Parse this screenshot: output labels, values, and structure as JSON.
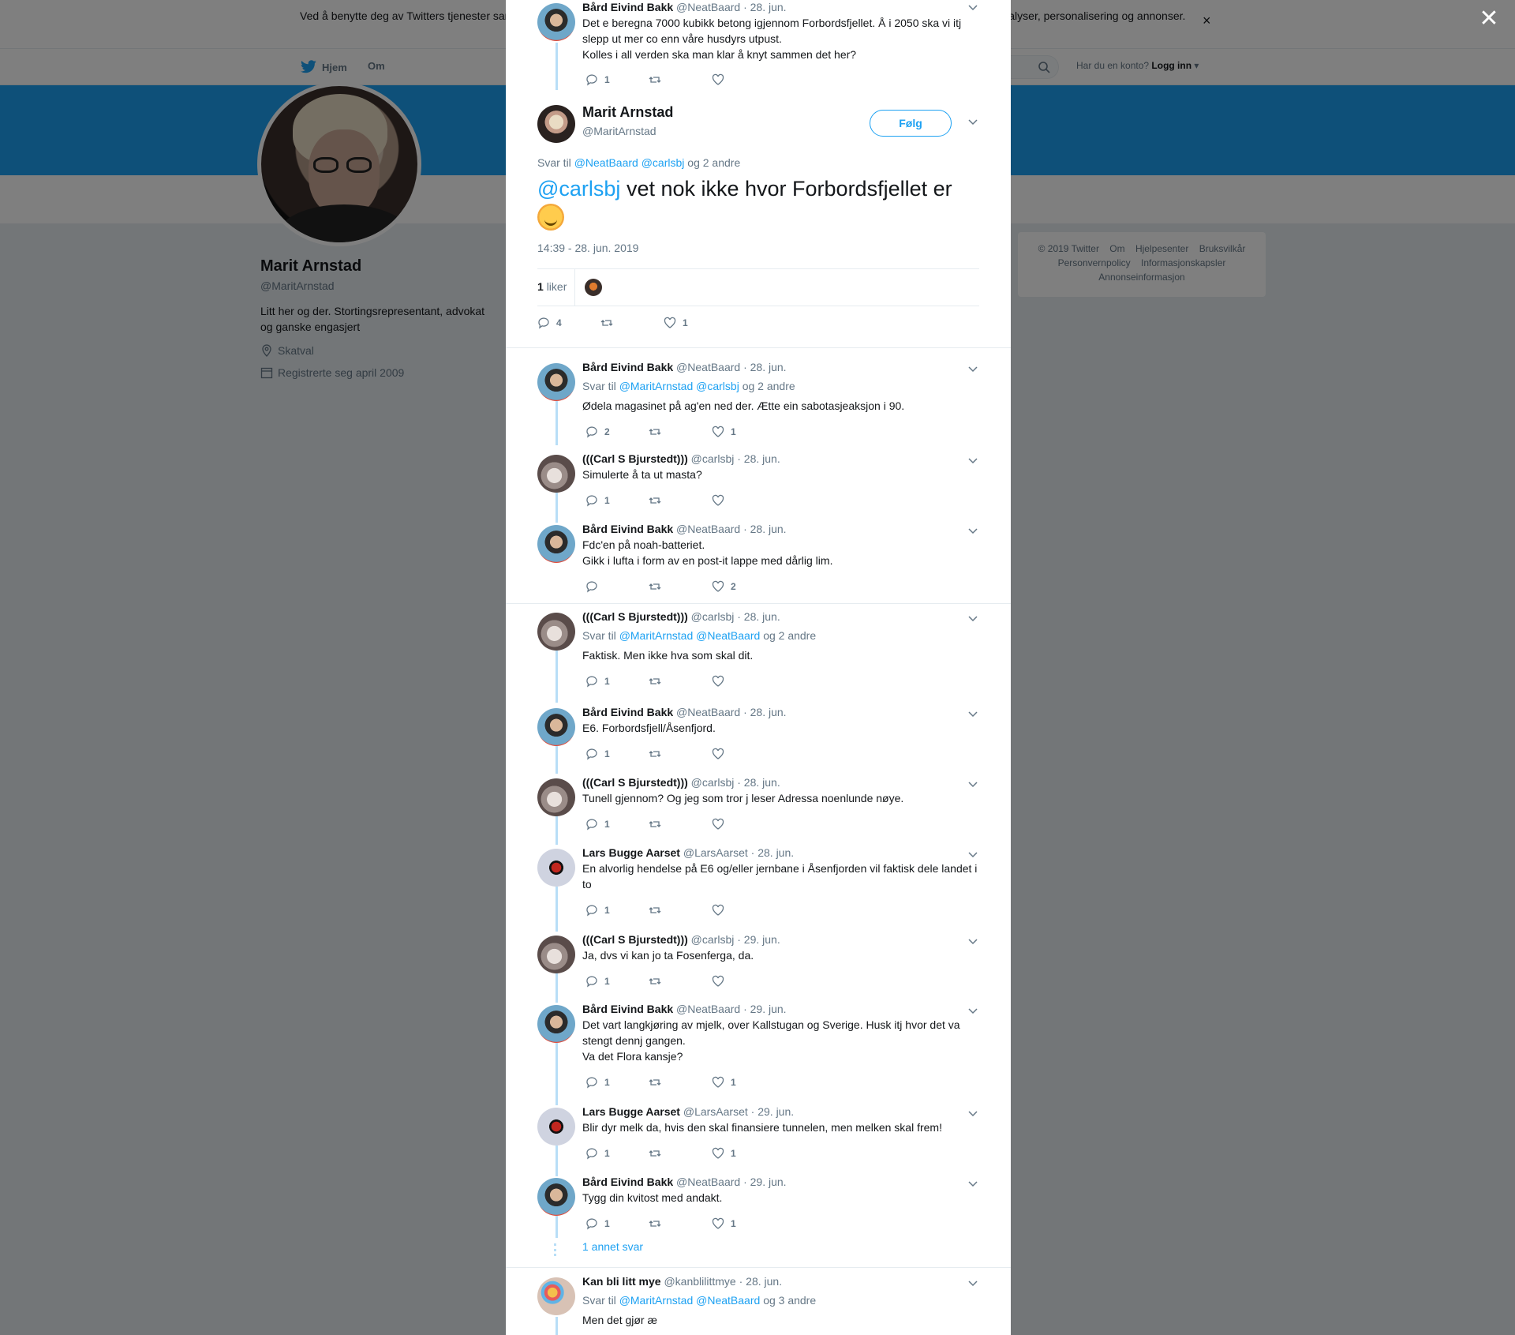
{
  "background": {
    "cookie_text": "Ved å benytte deg av Twitters tjenester samtykker du i vår bruk av informasjonskapsler. Vi og våre partnere bruker informasjonskapsler til bl.a. analyser, personalisering og annonser.",
    "nav": {
      "home": "Hjem",
      "about": "Om"
    },
    "login": {
      "question": "Har du en konto?",
      "action": "Logg inn"
    },
    "profile": {
      "name": "Marit Arnstad",
      "handle": "@MaritArnstad",
      "bio": "Litt her og der. Stortingsrepresentant, advokat og ganske engasjert",
      "location": "Skatval",
      "joined": "Registrerte seg april 2009"
    },
    "footer": [
      "© 2019 Twitter",
      "Om",
      "Hjelpesenter",
      "Bruksvilkår",
      "Personvernpolicy",
      "Informasjonskapsler",
      "Annonseinformasjon"
    ]
  },
  "modal": {
    "top_tweet": {
      "name": "Bård Eivind Bakk",
      "handle": "@NeatBaard",
      "date": "· 28. jun.",
      "text1": "Det e beregna 7000 kubikk betong igjennom Forbordsfjellet. Å i 2050 ska vi itj slepp ut mer co enn våre husdyrs utpust.",
      "text2": "Kolles i all verden ska man klar å knyt sammen det her?",
      "replies": "1",
      "retweets": "",
      "likes": ""
    },
    "main_tweet": {
      "name": "Marit Arnstad",
      "handle": "@MaritArnstad",
      "follow": "Følg",
      "reply_prefix": "Svar til",
      "reply_mentions": "@NeatBaard @carlsbj",
      "reply_suffix": "og 2 andre",
      "mention": "@carlsbj",
      "text": " vet nok ikke hvor Forbordsfjellet er ",
      "time": "14:39 - 28. jun. 2019",
      "likes_count": "1",
      "likes_label": "liker",
      "replies": "4",
      "retweets": "",
      "likes": "1"
    },
    "replies": [
      {
        "name": "Bård Eivind Bakk",
        "handle": "@NeatBaard",
        "date": "· 28. jun.",
        "reply_prefix": "Svar til",
        "reply_mentions": "@MaritArnstad @carlsbj",
        "reply_suffix": "og 2 andre",
        "text1": "Ødela magasinet på ag'en ned der. Ætte ein sabotasjeaksjon i 90.",
        "text2": "",
        "replies": "2",
        "likes": "1"
      },
      {
        "name": "(((Carl S Bjurstedt)))",
        "handle": "@carlsbj",
        "date": "· 28. jun.",
        "text1": "Simulerte å ta ut masta?",
        "text2": "",
        "replies": "1",
        "likes": ""
      },
      {
        "name": "Bård Eivind Bakk",
        "handle": "@NeatBaard",
        "date": "· 28. jun.",
        "text1": "Fdc'en på noah-batteriet.",
        "text2": "Gikk i lufta i form av en post-it lappe med dårlig lim.",
        "replies": "",
        "likes": "2"
      },
      {
        "name": "(((Carl S Bjurstedt)))",
        "handle": "@carlsbj",
        "date": "· 28. jun.",
        "reply_prefix": "Svar til",
        "reply_mentions": "@MaritArnstad @NeatBaard",
        "reply_suffix": "og 2 andre",
        "text1": "Faktisk. Men ikke hva som skal dit.",
        "text2": "",
        "replies": "1",
        "likes": ""
      },
      {
        "name": "Bård Eivind Bakk",
        "handle": "@NeatBaard",
        "date": "· 28. jun.",
        "text1": "E6. Forbordsfjell/Åsenfjord.",
        "text2": "",
        "replies": "1",
        "likes": ""
      },
      {
        "name": "(((Carl S Bjurstedt)))",
        "handle": "@carlsbj",
        "date": "· 28. jun.",
        "text1": "Tunell gjennom? Og jeg som tror j leser Adressa noenlunde nøye.",
        "text2": "",
        "replies": "1",
        "likes": ""
      },
      {
        "name": "Lars Bugge Aarset",
        "handle": "@LarsAarset",
        "date": "· 28. jun.",
        "text1": "En alvorlig hendelse på E6 og/eller jernbane i Åsenfjorden vil faktisk dele landet i to",
        "text2": "",
        "replies": "1",
        "likes": ""
      },
      {
        "name": "(((Carl S Bjurstedt)))",
        "handle": "@carlsbj",
        "date": "· 29. jun.",
        "text1": "Ja, dvs vi kan jo ta Fosenferga, da.",
        "text2": "",
        "replies": "1",
        "likes": ""
      },
      {
        "name": "Bård Eivind Bakk",
        "handle": "@NeatBaard",
        "date": "· 29. jun.",
        "text1": "Det vart langkjøring av mjelk, over Kallstugan og Sverige. Husk itj hvor det va stengt dennj gangen.",
        "text2": "Va det Flora kansje?",
        "replies": "1",
        "likes": "1"
      },
      {
        "name": "Lars Bugge Aarset",
        "handle": "@LarsAarset",
        "date": "· 29. jun.",
        "text1": "Blir dyr melk da, hvis den skal finansiere tunnelen, men melken skal frem!",
        "text2": "",
        "replies": "1",
        "likes": "1"
      },
      {
        "name": "Bård Eivind Bakk",
        "handle": "@NeatBaard",
        "date": "· 29. jun.",
        "text1": "Tygg din kvitost med andakt.",
        "text2": "",
        "replies": "1",
        "likes": "1"
      }
    ],
    "more_replies": "1 annet svar",
    "last_tweet": {
      "name": "Kan bli litt mye",
      "handle": "@kanblilittmye",
      "date": "· 28. jun.",
      "reply_prefix": "Svar til",
      "reply_mentions": "@MaritArnstad @NeatBaard",
      "reply_suffix": "og 3 andre",
      "text1": "Men det gjør æ"
    }
  }
}
